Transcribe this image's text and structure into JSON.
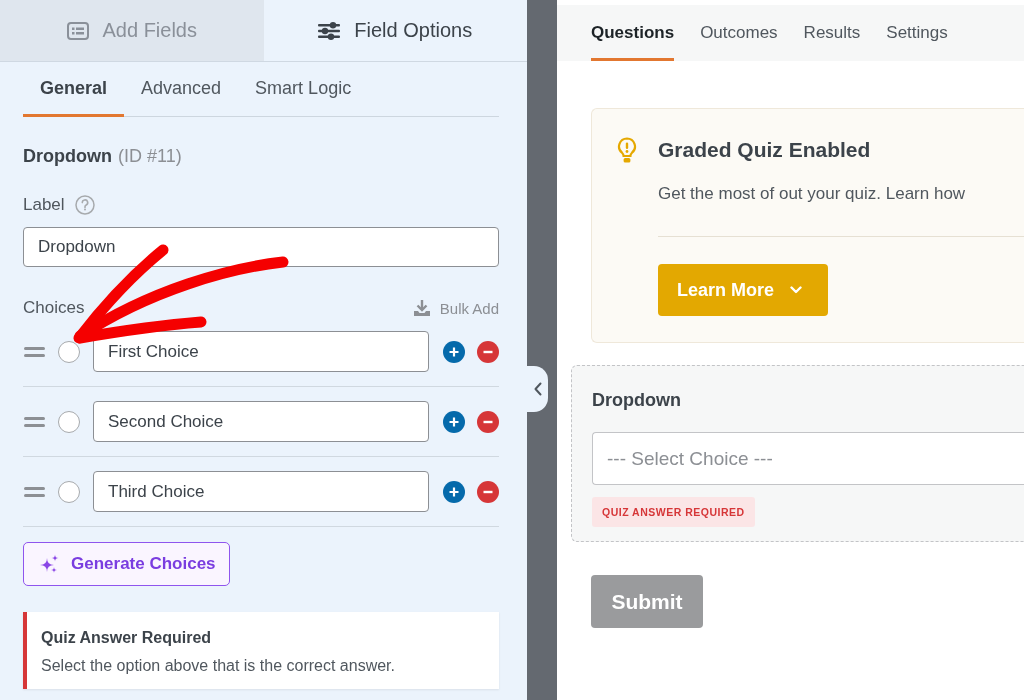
{
  "left_panel": {
    "panel_tabs": [
      {
        "label": "Add Fields",
        "selected": false
      },
      {
        "label": "Field Options",
        "selected": true
      }
    ],
    "option_tabs": [
      {
        "label": "General",
        "selected": true
      },
      {
        "label": "Advanced",
        "selected": false
      },
      {
        "label": "Smart Logic",
        "selected": false
      }
    ],
    "field_heading": {
      "name": "Dropdown",
      "id": "(ID #11)"
    },
    "label_field": {
      "label": "Label",
      "value": "Dropdown"
    },
    "choices": {
      "label": "Choices",
      "bulk_add": "Bulk Add",
      "items": [
        {
          "value": "First Choice",
          "selected": false
        },
        {
          "value": "Second Choice",
          "selected": false
        },
        {
          "value": "Third Choice",
          "selected": false
        }
      ]
    },
    "generate_button": "Generate Choices",
    "notice": {
      "title": "Quiz Answer Required",
      "text": "Select the option above that is the correct answer."
    }
  },
  "right_panel": {
    "tabs": [
      {
        "label": "Questions",
        "selected": true
      },
      {
        "label": "Outcomes",
        "selected": false
      },
      {
        "label": "Results",
        "selected": false
      },
      {
        "label": "Settings",
        "selected": false
      }
    ],
    "quiz_notice": {
      "title": "Graded Quiz Enabled",
      "text": "Get the most of out your quiz. Learn how",
      "button": "Learn More"
    },
    "field_preview": {
      "label": "Dropdown",
      "placeholder": "--- Select Choice ---",
      "badge": "QUIZ ANSWER REQUIRED"
    },
    "submit_button": "Submit"
  }
}
